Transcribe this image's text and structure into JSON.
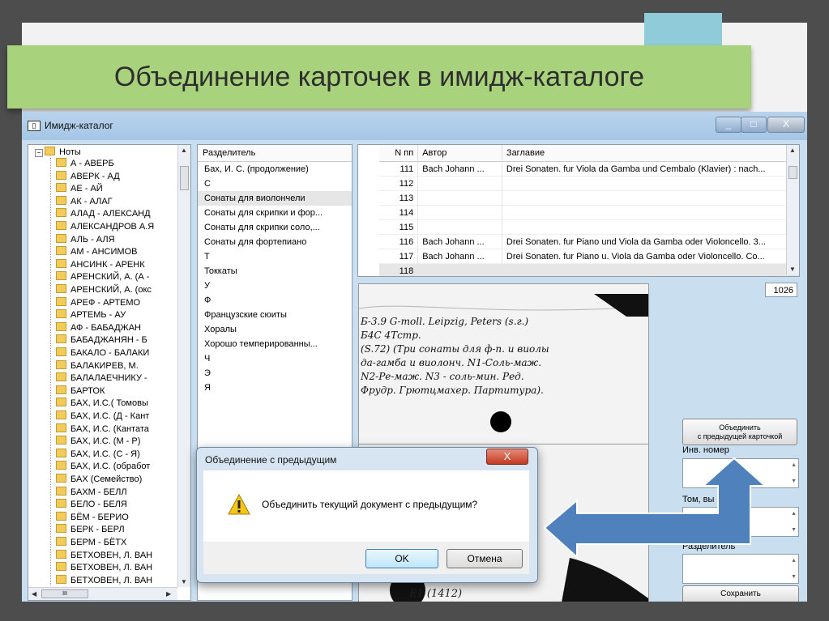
{
  "slide": {
    "title": "Объединение карточек в имидж-каталоге"
  },
  "window": {
    "title": "Имидж-каталог",
    "minimize": "_",
    "maximize": "□",
    "close": "X"
  },
  "tree": {
    "root": "Ноты",
    "items": [
      "А - АВЕРБ",
      "АВЕРК - АД",
      "АЕ - АЙ",
      "АК - АЛАГ",
      "АЛАД - АЛЕКСАНД",
      "АЛЕКСАНДРОВ А.Я",
      "АЛЬ - АЛЯ",
      "АМ - АНСИМОВ",
      "АНСИНК - АРЕНК",
      "АРЕНСКИЙ, А. (А -",
      "АРЕНСКИЙ, А. (окс",
      "АРЕФ - АРТЕМО",
      "АРТЕМЬ - АУ",
      "АФ - БАБАДЖАН",
      "БАБАДЖАНЯН - Б",
      "БАКАЛО - БАЛАКИ",
      "БАЛАКИРЕВ, М.",
      "БАЛАЛАЕЧНИКУ -",
      "БАРТОК",
      "БАХ, И.С.( Томовы",
      "БАХ, И.С. (Д - Кант",
      "БАХ, И.С. (Кантата",
      "БАХ, И.С. (М - Р)",
      "БАХ, И.С. (С - Я)",
      "БАХ, И.С. (обработ",
      "БАХ (Семейство)",
      "БАХМ - БЕЛЛ",
      "БЕЛО - БЕЛЯ",
      "БЁМ - БЕРИО",
      "БЕРК - БЕРЛ",
      "БЕРМ - БЁТХ",
      "БЕТХОВЕН, Л. ВАН",
      "БЕТХОВЕН, Л. ВАН",
      "БЕТХОВЕН, Л. ВАН"
    ],
    "hscroll_label": "III"
  },
  "razdelitel_list": {
    "header": "Разделитель",
    "items": [
      "Бах, И. С. (продолжение)",
      "С",
      "Сонаты для виолончели",
      "Сонаты для скрипки и фор...",
      "Сонаты для скрипки соло,...",
      "Сонаты для фортепиано",
      "Т",
      "Токкаты",
      "У",
      "Ф",
      "Французские сюиты",
      "Хоралы",
      "Хорошо темперированны...",
      "Ч",
      "Э",
      "Я"
    ],
    "selected_index": 2
  },
  "table": {
    "columns": [
      "N пп",
      "Автор",
      "Заглавие"
    ],
    "rows": [
      [
        "111",
        "Bach Johann ...",
        "Drei Sonaten. fur Viola da Gamba und Cembalo (Klavier) : nach..."
      ],
      [
        "112",
        "",
        ""
      ],
      [
        "113",
        "",
        ""
      ],
      [
        "114",
        "",
        ""
      ],
      [
        "115",
        "",
        ""
      ],
      [
        "116",
        "Bach Johann ...",
        "Drei Sonaten. fur Piano und Viola da Gamba oder Violoncello. 3..."
      ],
      [
        "117",
        "Bach Johann ...",
        "Drei Sonaten. fur Piano u. Viola da Gamba oder Violoncello. Co..."
      ],
      [
        "118",
        "",
        ""
      ]
    ],
    "selected_row": 7
  },
  "card_image": {
    "lines": [
      "Б-3.9   G-moll.    Leipzig, Peters (s.г.)",
      "Б4С      4Тстр.",
      "(S.72)   (Три сонаты для ф-п. и виолы",
      "           да-гамба и виолонч. N1-Соль-маж.",
      "           N2-Ре-маж. N3 - соль-мин. Ред.",
      "           Фрудр. Грютцмахер. Партитура)."
    ]
  },
  "card_image_2": {
    "fragment": "E1 (1412)"
  },
  "right_panel": {
    "counter": "1026",
    "merge_button": {
      "line1": "Объединить",
      "line2": "с предыдущей карточкой"
    },
    "inv_label": "Инв. номер",
    "tom_label": "Том, вы",
    "razd_label": "Разделитель",
    "save_button": "Сохранить"
  },
  "dialog": {
    "title": "Объединение с предыдущим",
    "close": "X",
    "message": "Объединить текущий документ с предыдущим?",
    "ok": "OK",
    "cancel": "Отмена"
  },
  "colors": {
    "banner": "#a9d27c",
    "arrow": "#4f81bd",
    "teal_accent": "#8fcbd9"
  }
}
